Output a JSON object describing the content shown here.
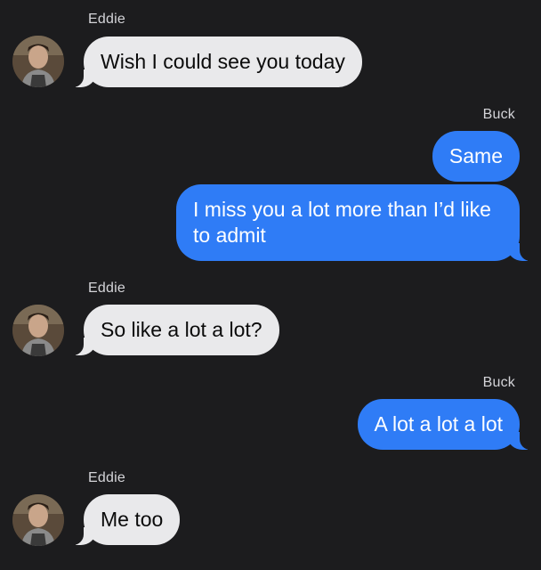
{
  "messages": [
    {
      "sender": "Eddie",
      "direction": "incoming",
      "bubbles": [
        "Wish I could see you today"
      ]
    },
    {
      "sender": "Buck",
      "direction": "outgoing",
      "bubbles": [
        "Same",
        "I miss you a lot more than I’d like to admit"
      ]
    },
    {
      "sender": "Eddie",
      "direction": "incoming",
      "bubbles": [
        "So like a lot a lot?"
      ]
    },
    {
      "sender": "Buck",
      "direction": "outgoing",
      "bubbles": [
        "A lot a lot a lot"
      ]
    },
    {
      "sender": "Eddie",
      "direction": "incoming",
      "bubbles": [
        "Me too"
      ]
    }
  ],
  "colors": {
    "background": "#1c1c1e",
    "incoming_bubble": "#e9e9eb",
    "outgoing_bubble": "#2f7cf6",
    "sender_label": "#d4d4d8"
  },
  "icons": {
    "avatar": "contact-photo-icon"
  }
}
